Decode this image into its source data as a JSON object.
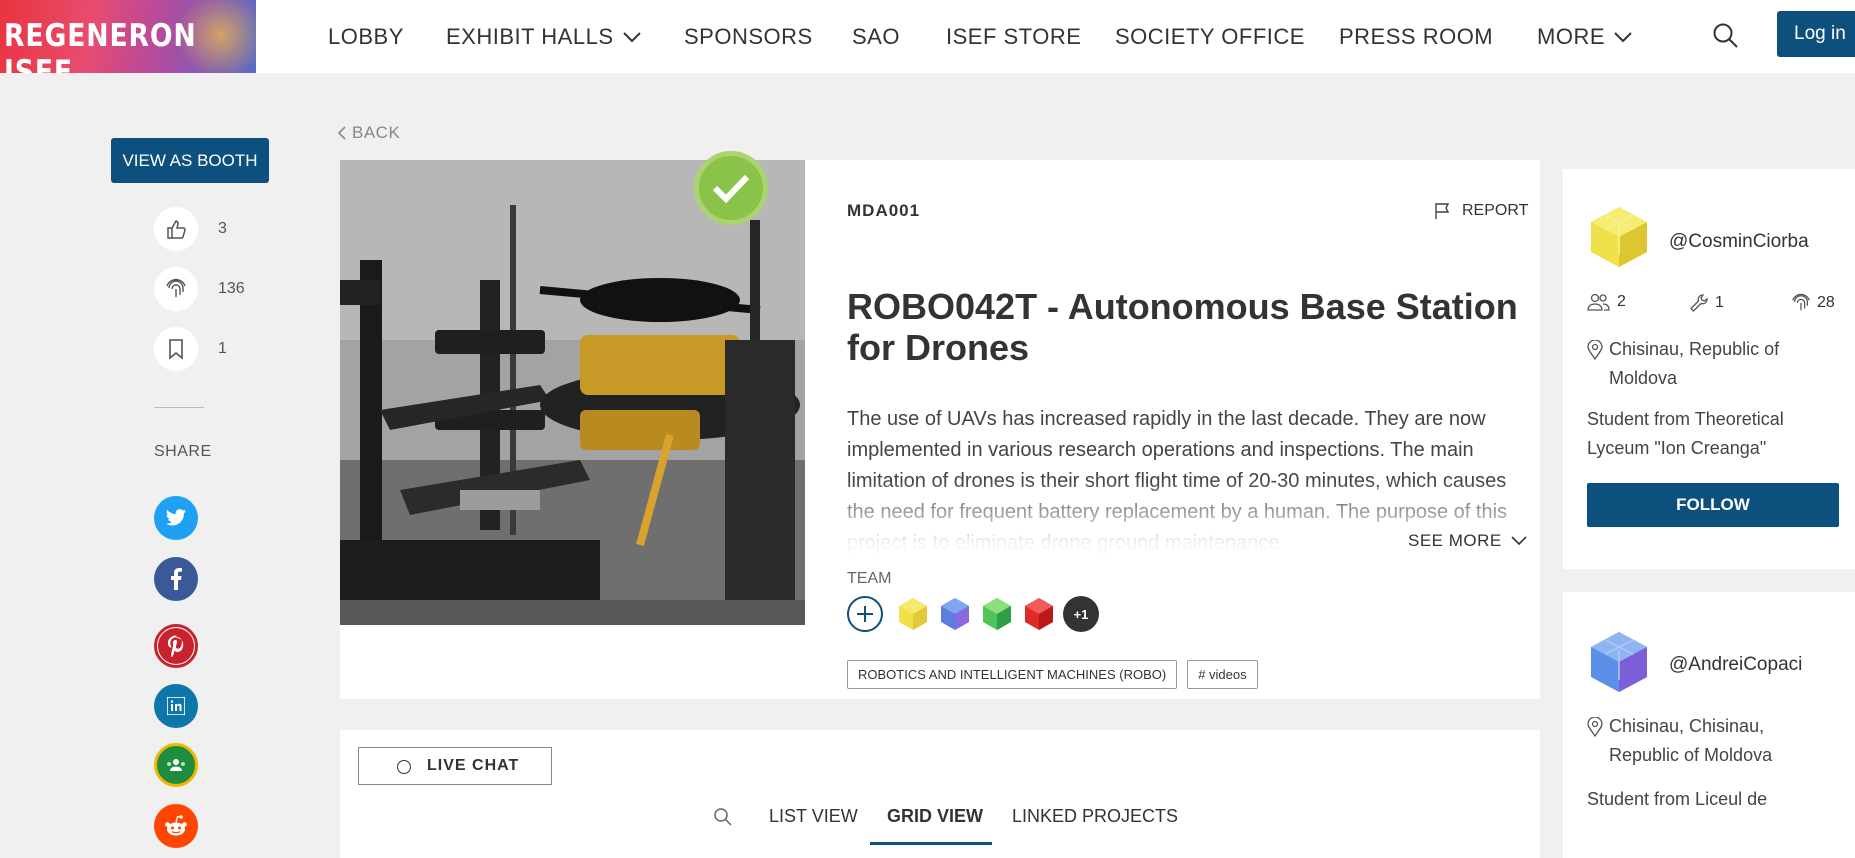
{
  "header": {
    "logo_text": "REGENERON ISEF",
    "nav": [
      "LOBBY",
      "EXHIBIT HALLS",
      "SPONSORS",
      "SAO",
      "ISEF STORE",
      "SOCIETY OFFICE",
      "PRESS ROOM",
      "MORE"
    ],
    "login_label": "Log in"
  },
  "sidebar": {
    "booth_label": "VIEW AS BOOTH",
    "likes": "3",
    "views": "136",
    "bookmarks": "1",
    "share_label": "SHARE",
    "social_icons": [
      "twitter-icon",
      "facebook-icon",
      "pinterest-icon",
      "linkedin-icon",
      "google-classroom-icon",
      "reddit-icon"
    ]
  },
  "back_label": "BACK",
  "project": {
    "code": "MDA001",
    "report_label": "REPORT",
    "title": "ROBO042T - Autonomous Base Station for Drones",
    "description": "The use of UAVs has increased rapidly in the last decade. They are now implemented in various research operations and inspections. The main limitation of drones is their short flight time of 20-30 minutes, which causes the need for frequent battery replacement by a human. The purpose of this project is to eliminate drone ground maintenance",
    "see_more_label": "SEE MORE",
    "team_label": "TEAM",
    "team_more": "+1",
    "tags": [
      "ROBOTICS AND INTELLIGENT MACHINES (ROBO)",
      "# videos"
    ]
  },
  "profiles": [
    {
      "username": "@CosminCiorba",
      "followers": "2",
      "projects": "1",
      "views": "28",
      "location": "Chisinau, Republic of Moldova",
      "school": "Student from Theoretical Lyceum \"Ion Creanga\"",
      "follow_label": "FOLLOW"
    },
    {
      "username": "@AndreiCopaci",
      "location": "Chisinau, Chisinau, Republic of Moldova",
      "school": "Student from Liceul de"
    }
  ],
  "bottom": {
    "live_chat_label": "LIVE CHAT",
    "tabs": [
      "LIST VIEW",
      "GRID VIEW",
      "LINKED PROJECTS"
    ],
    "active_tab": "GRID VIEW"
  },
  "colors": {
    "brand_blue": "#0d4f7d",
    "check_green": "#8bc34a",
    "twitter": "#1da1f2",
    "facebook": "#3b5998",
    "pinterest": "#c8232c",
    "linkedin": "#0e76a8",
    "classroom": "#1e8e3e",
    "reddit": "#ff4500"
  }
}
